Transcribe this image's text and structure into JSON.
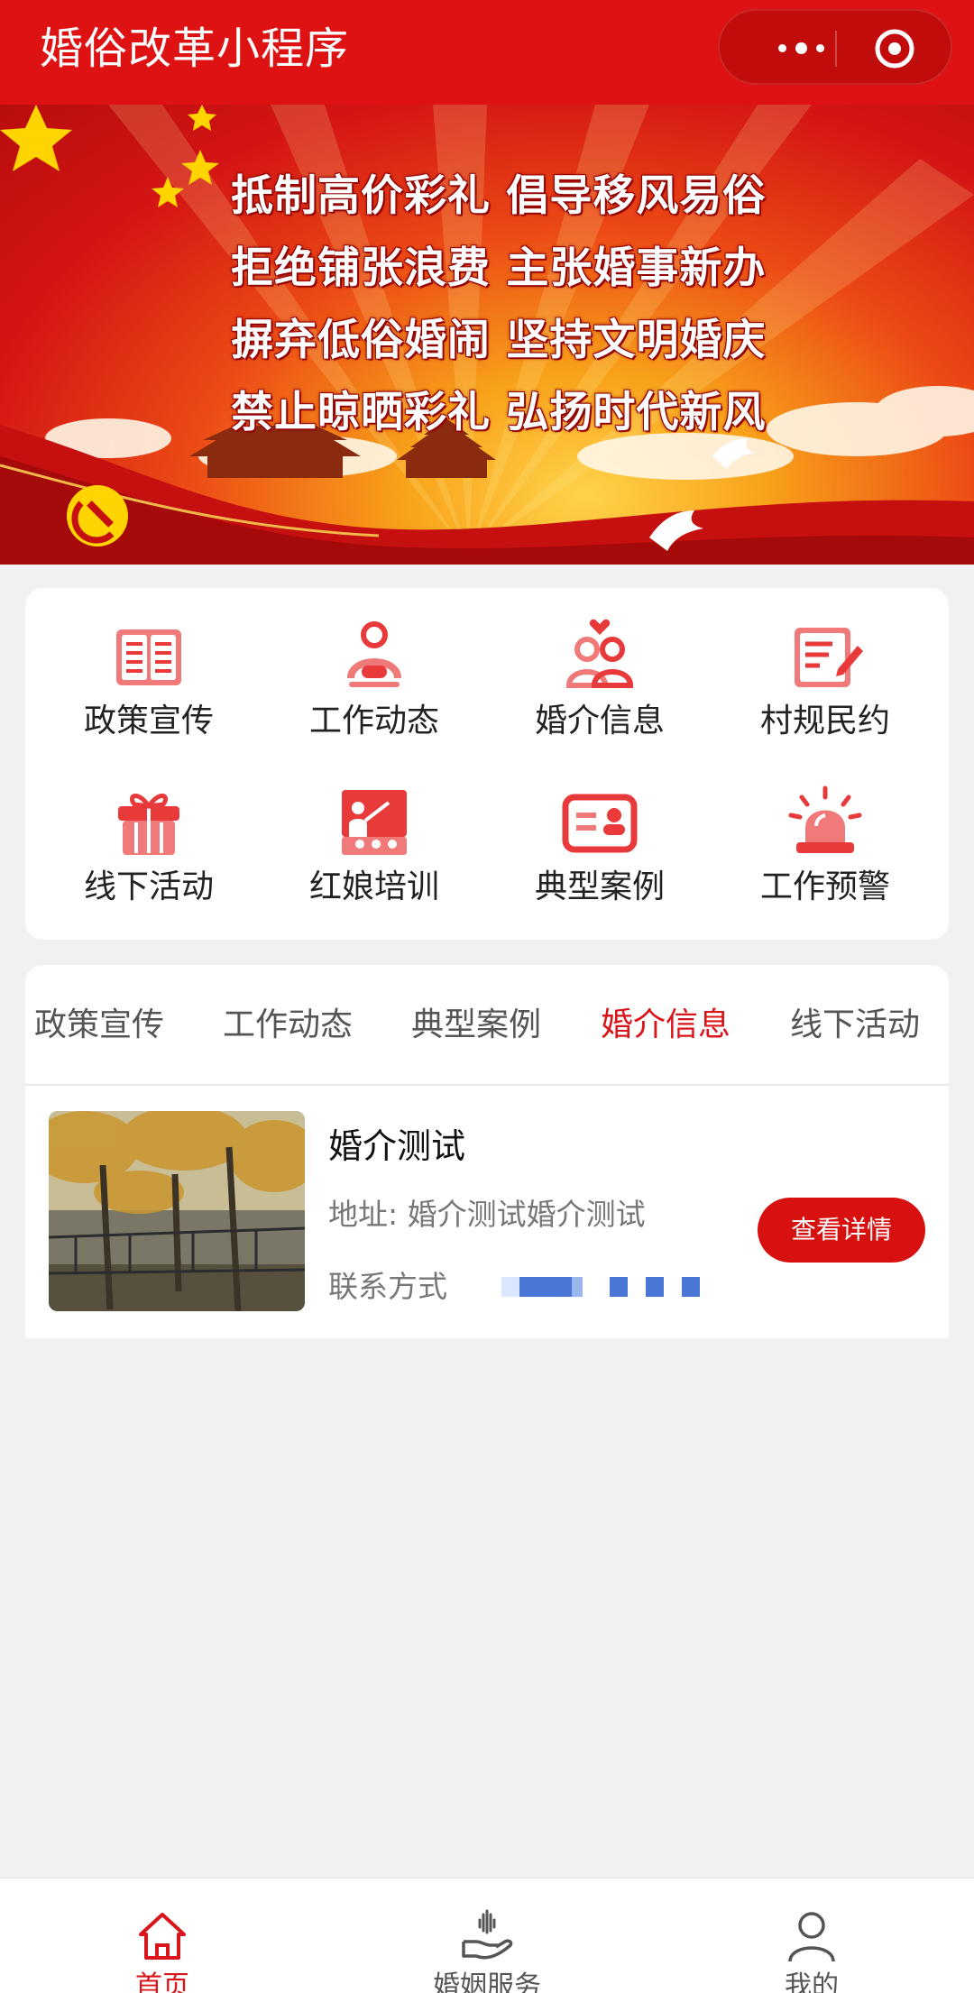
{
  "app": {
    "title": "婚俗改革小程序",
    "accent_color": "#de1212"
  },
  "capsule": {
    "more_icon": "more-dots-icon",
    "close_icon": "target-close-icon"
  },
  "banner": {
    "slogans": [
      "抵制高价彩礼 倡导移风易俗",
      "拒绝铺张浪费 主张婚事新办",
      "摒弃低俗婚闹 坚持文明婚庆",
      "禁止晾晒彩礼 弘扬时代新风"
    ],
    "active_slide": 1,
    "slide_count": 1
  },
  "categories": [
    {
      "label": "政策宣传",
      "icon": "book-icon"
    },
    {
      "label": "工作动态",
      "icon": "person-icon"
    },
    {
      "label": "婚介信息",
      "icon": "couple-icon"
    },
    {
      "label": "村规民约",
      "icon": "document-edit-icon"
    },
    {
      "label": "线下活动",
      "icon": "gift-icon"
    },
    {
      "label": "红娘培训",
      "icon": "training-icon"
    },
    {
      "label": "典型案例",
      "icon": "id-card-icon"
    },
    {
      "label": "工作预警",
      "icon": "alarm-icon"
    }
  ],
  "tabs": {
    "items": [
      "政策宣传",
      "工作动态",
      "典型案例",
      "婚介信息",
      "线下活动"
    ],
    "active": "婚介信息"
  },
  "list": [
    {
      "title": "婚介测试",
      "address_label": "地址:",
      "address": "婚介测试婚介测试",
      "contact_label": "联系方式",
      "button": "查看详情"
    }
  ],
  "tabbar": {
    "items": [
      {
        "label": "首页",
        "icon": "home-icon"
      },
      {
        "label": "婚姻服务",
        "icon": "hand-heart-icon"
      },
      {
        "label": "我的",
        "icon": "user-icon"
      }
    ],
    "active": "首页"
  }
}
